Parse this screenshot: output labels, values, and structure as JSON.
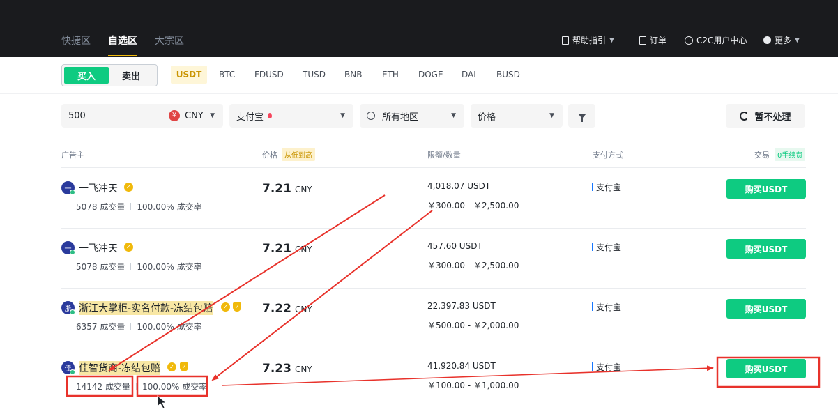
{
  "nav": {
    "tabs": [
      {
        "label": "快捷区"
      },
      {
        "label": "自选区"
      },
      {
        "label": "大宗区"
      }
    ],
    "links": [
      {
        "label": "帮助指引",
        "icon": "help-doc-icon"
      },
      {
        "label": "订单",
        "icon": "order-icon"
      },
      {
        "label": "C2C用户中心",
        "icon": "user-icon"
      },
      {
        "label": "更多",
        "icon": "more-icon"
      }
    ]
  },
  "trade_toggle": {
    "buy": "买入",
    "sell": "卖出"
  },
  "coins": [
    "USDT",
    "BTC",
    "FDUSD",
    "TUSD",
    "BNB",
    "ETH",
    "DOGE",
    "DAI",
    "BUSD"
  ],
  "filters": {
    "amount_value": "500",
    "currency": "CNY",
    "currency_symbol": "¥",
    "payment": "支付宝",
    "region": "所有地区",
    "sort": "价格",
    "refresh_label": "暂不处理"
  },
  "table_header": {
    "advertiser": "广告主",
    "price": "价格",
    "price_sort": "从低到高",
    "limit": "限额/数量",
    "payment": "支付方式",
    "trade": "交易",
    "fee_badge": "0手续费"
  },
  "rows": [
    {
      "avatar": "一",
      "name": "一飞冲天",
      "orders": "5078 成交量",
      "rate": "100.00% 成交率",
      "price": "7.21",
      "currency": "CNY",
      "available": "4,018.07 USDT",
      "limit": "￥300.00 - ￥2,500.00",
      "payment": "支付宝",
      "button": "购买USDT"
    },
    {
      "avatar": "一",
      "name": "一飞冲天",
      "orders": "5078 成交量",
      "rate": "100.00% 成交率",
      "price": "7.21",
      "currency": "CNY",
      "available": "457.60 USDT",
      "limit": "￥300.00 - ￥2,500.00",
      "payment": "支付宝",
      "button": "购买USDT"
    },
    {
      "avatar": "浙",
      "name": "浙江大掌柜-实名付款-冻结包赔",
      "orders": "6357 成交量",
      "rate": "100.00% 成交率",
      "price": "7.22",
      "currency": "CNY",
      "available": "22,397.83 USDT",
      "limit": "￥500.00 - ￥2,000.00",
      "payment": "支付宝",
      "button": "购买USDT"
    },
    {
      "avatar": "佳",
      "name": "佳智货商-冻结包赔",
      "orders": "14142 成交量",
      "rate": "100.00% 成交率",
      "price": "7.23",
      "currency": "CNY",
      "available": "41,920.84 USDT",
      "limit": "￥100.00 - ￥1,000.00",
      "payment": "支付宝",
      "button": "购买USDT"
    }
  ],
  "colors": {
    "accent": "#f0b90b",
    "buy": "#0ecb81",
    "annotation": "#e8322b"
  }
}
